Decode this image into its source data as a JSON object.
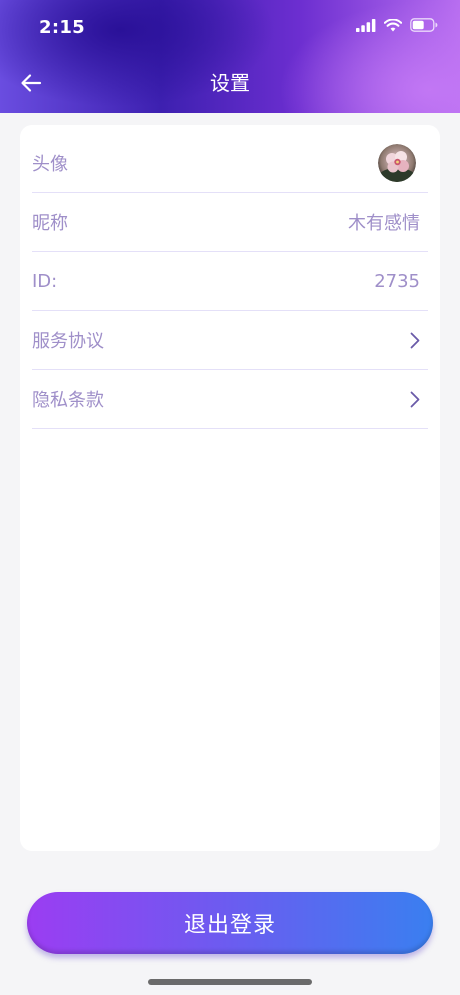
{
  "status_bar": {
    "time": "2:15",
    "icons": [
      "signal-icon",
      "wifi-icon",
      "battery-icon"
    ]
  },
  "nav": {
    "title": "设置",
    "back_icon": "back-arrow-icon"
  },
  "settings": {
    "rows": [
      {
        "label": "头像",
        "type": "avatar"
      },
      {
        "label": "昵称",
        "value": "木有感情"
      },
      {
        "label": "ID:",
        "value": "2735"
      },
      {
        "label": "服务协议",
        "type": "link",
        "icon": "chevron-right-icon"
      },
      {
        "label": "隐私条款",
        "type": "link",
        "icon": "chevron-right-icon"
      }
    ]
  },
  "logout": {
    "label": "退出登录"
  },
  "colors": {
    "row_text": "#9f8fc9",
    "divider": "#e4e0f8",
    "logout_gradient_start": "#9b3df2",
    "logout_gradient_end": "#3a7ff0",
    "header_primary": "#3d20b0"
  }
}
